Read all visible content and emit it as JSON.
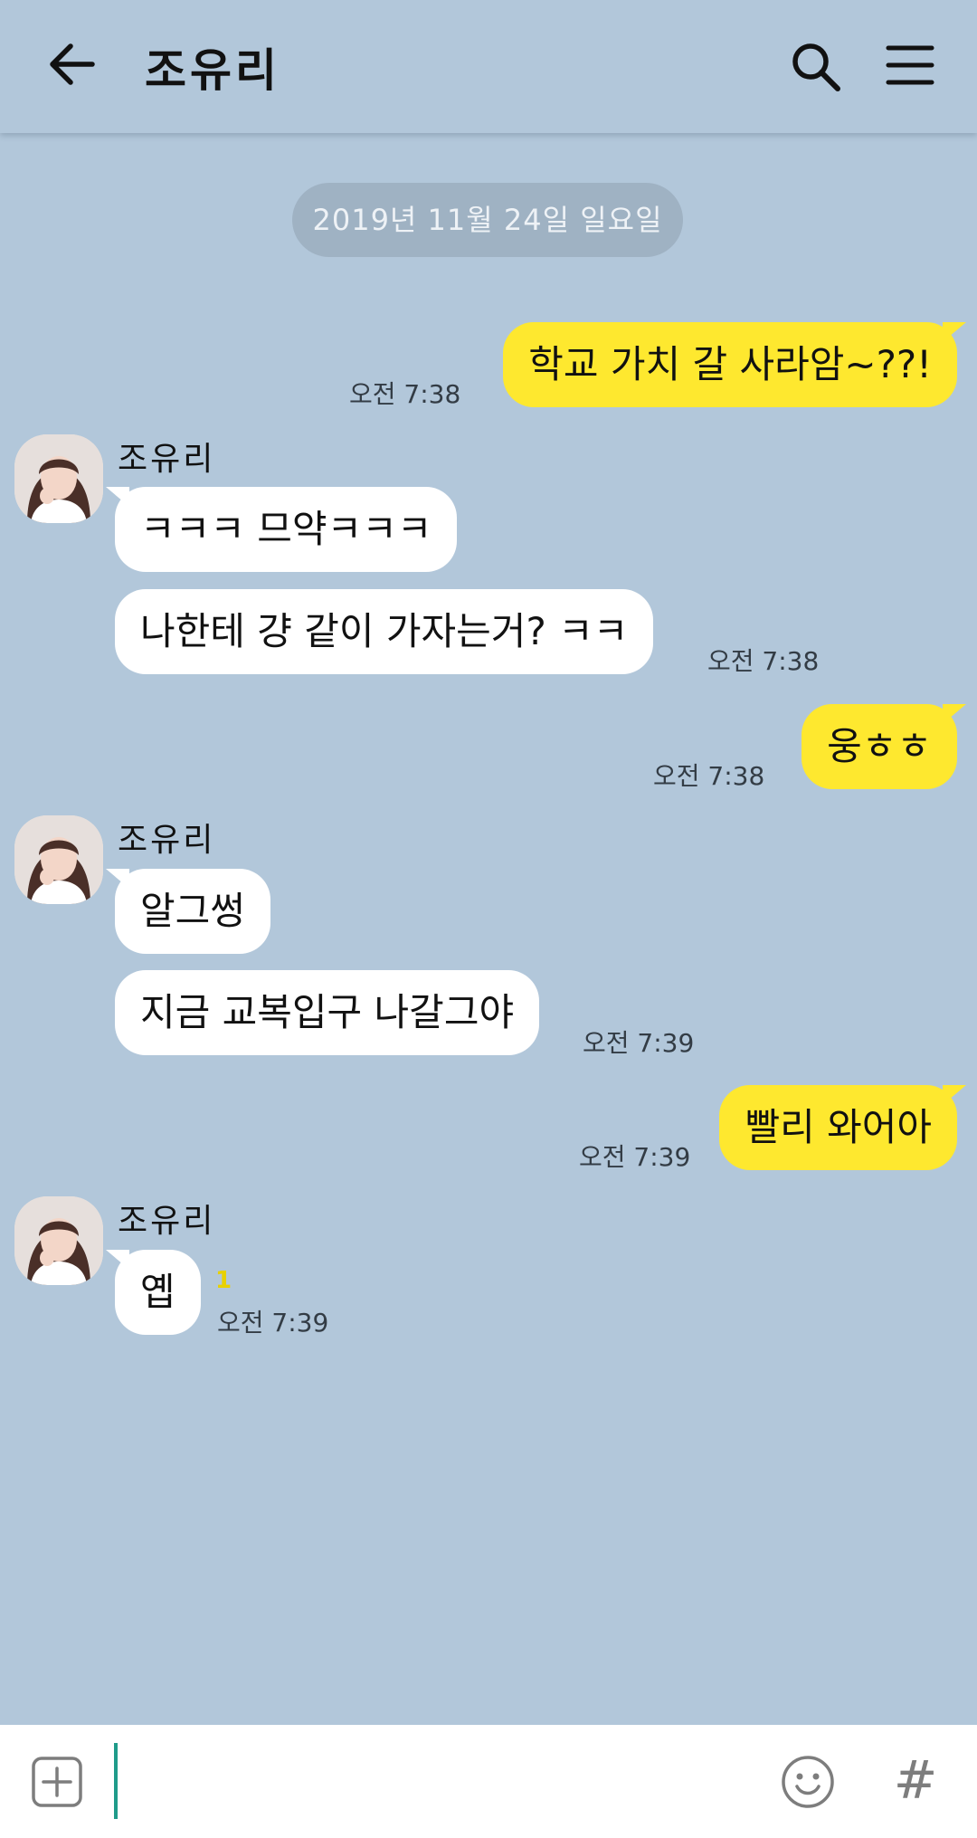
{
  "header": {
    "title": "조유리",
    "back_icon": "arrow-left-icon",
    "search_icon": "search-icon",
    "menu_icon": "hamburger-menu-icon"
  },
  "date_divider": "2019년 11월 24일 일요일",
  "contact": {
    "name": "조유리"
  },
  "messages": [
    {
      "from": "me",
      "text": "학교 가치 갈 사라암~??!",
      "time": "오전 7:38"
    },
    {
      "from": "조유리",
      "text": "ㅋㅋㅋ 므약ㅋㅋㅋ",
      "time": ""
    },
    {
      "from": "조유리",
      "text": "나한테 걍 같이 가자는거? ㅋㅋ",
      "time": "오전 7:38"
    },
    {
      "from": "me",
      "text": "웅ㅎㅎ",
      "time": "오전 7:38"
    },
    {
      "from": "조유리",
      "text": "알그썽",
      "time": ""
    },
    {
      "from": "조유리",
      "text": "지금 교복입구 나갈그야",
      "time": "오전 7:39"
    },
    {
      "from": "me",
      "text": "빨리 와어아",
      "time": "오전 7:39"
    },
    {
      "from": "조유리",
      "text": "옙",
      "time": "오전 7:39",
      "unread": "1"
    }
  ],
  "input": {
    "value": "",
    "plus_icon": "plus-box-icon",
    "emoji_icon": "emoji-icon",
    "hash_label": "#"
  },
  "colors": {
    "background": "#b2c7da",
    "my_bubble": "#fee82f",
    "their_bubble": "#ffffff",
    "cursor": "#1f9b8a"
  }
}
